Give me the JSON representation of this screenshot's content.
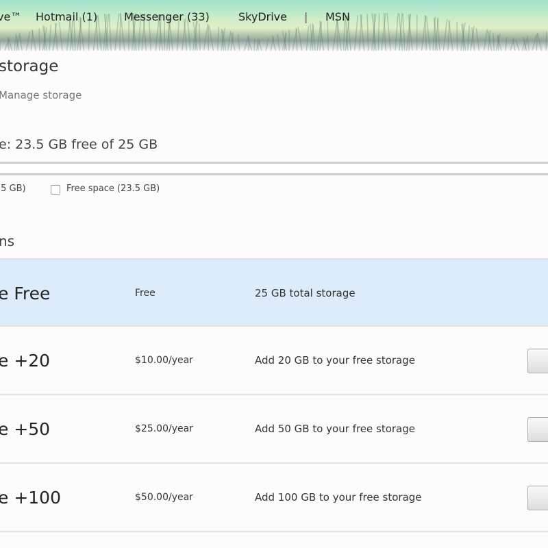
{
  "nav": {
    "items": [
      "ve™",
      "Hotmail (1)",
      "Messenger (33)",
      "SkyDrive",
      "|",
      "MSN"
    ]
  },
  "page": {
    "title": "storage",
    "breadcrumb": "Manage storage",
    "usage": "e: 23.5 GB free of 25 GB"
  },
  "legend": {
    "used": ".5 GB)",
    "free": "Free space (23.5 GB)"
  },
  "section": "ns",
  "plans": [
    {
      "name": "e Free",
      "price": "Free",
      "desc": "25 GB total storage",
      "current": true
    },
    {
      "name": "e +20",
      "price": "$10.00/year",
      "desc": "Add 20 GB to your free storage"
    },
    {
      "name": "e +50",
      "price": "$25.00/year",
      "desc": "Add 50 GB to your free storage"
    },
    {
      "name": "e +100",
      "price": "$50.00/year",
      "desc": "Add 100 GB to your free storage"
    }
  ]
}
